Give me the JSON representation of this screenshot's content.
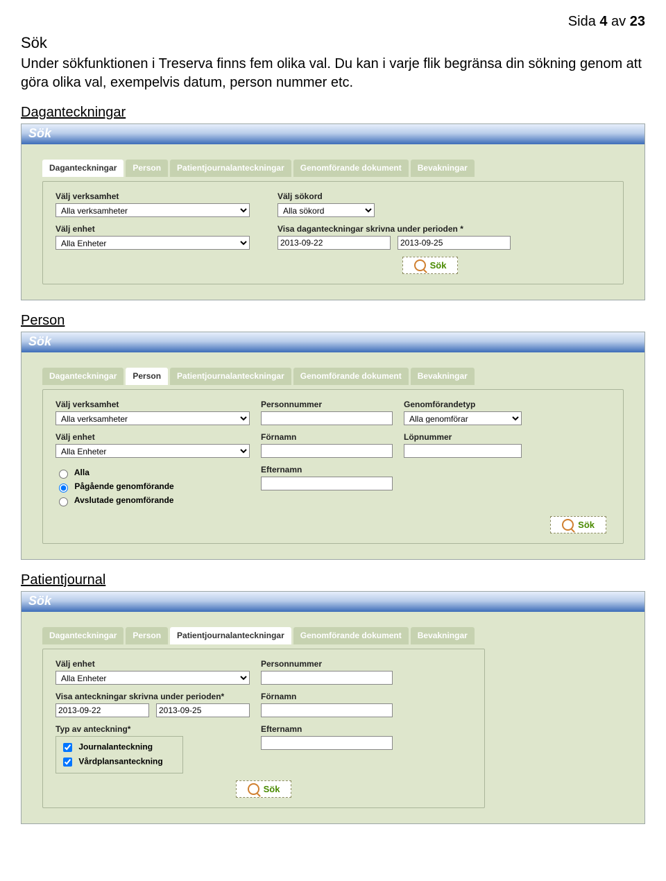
{
  "page": {
    "page_label_pre": "Sida ",
    "page_current": "4",
    "page_label_mid": " av ",
    "page_total": "23",
    "heading": "Sök",
    "intro": "Under sökfunktionen i Treserva finns fem olika val. Du kan i varje flik begränsa din sökning genom att göra olika val, exempelvis datum, person nummer etc."
  },
  "tabs": [
    "Daganteckningar",
    "Person",
    "Patientjournalanteckningar",
    "Genomförande dokument",
    "Bevakningar"
  ],
  "section1": {
    "link": "Daganteckningar",
    "panel_title": "Sök",
    "active_tab": 0,
    "fields": {
      "verksamhet_label": "Välj verksamhet",
      "verksamhet_value": "Alla verksamheter",
      "enhet_label": "Välj enhet",
      "enhet_value": "Alla Enheter",
      "sokord_label": "Välj sökord",
      "sokord_value": "Alla sökord",
      "period_label": "Visa daganteckningar skrivna under perioden *",
      "date_from": "2013-09-22",
      "date_to": "2013-09-25",
      "sok_btn": "Sök"
    }
  },
  "section2": {
    "link": "Person",
    "panel_title": "Sök",
    "active_tab": 1,
    "fields": {
      "verksamhet_label": "Välj verksamhet",
      "verksamhet_value": "Alla verksamheter",
      "enhet_label": "Välj enhet",
      "enhet_value": "Alla Enheter",
      "radio_alla": "Alla",
      "radio_pagaende": "Pågående genomförande",
      "radio_avslutade": "Avslutade genomförande",
      "personnummer_label": "Personnummer",
      "fornamn_label": "Förnamn",
      "efternamn_label": "Efternamn",
      "genomforandetyp_label": "Genomförandetyp",
      "genomforandetyp_value": "Alla genomförar",
      "lopnummer_label": "Löpnummer",
      "sok_btn": "Sök"
    }
  },
  "section3": {
    "link": "Patientjournal",
    "panel_title": "Sök",
    "active_tab": 2,
    "fields": {
      "enhet_label": "Välj enhet",
      "enhet_value": "Alla Enheter",
      "period_label": "Visa anteckningar skrivna under perioden*",
      "date_from": "2013-09-22",
      "date_to": "2013-09-25",
      "anteckningstyp_label": "Typ av anteckning*",
      "chk_journal": "Journalanteckning",
      "chk_vardplan": "Vårdplansanteckning",
      "personnummer_label": "Personnummer",
      "fornamn_label": "Förnamn",
      "efternamn_label": "Efternamn",
      "sok_btn": "Sök"
    }
  }
}
